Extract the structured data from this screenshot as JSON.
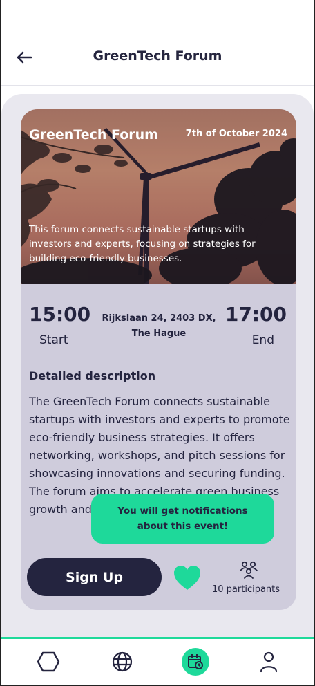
{
  "header": {
    "title": "GreenTech Forum",
    "back_icon": "arrow-left-icon"
  },
  "event": {
    "title": "GreenTech Forum",
    "date": "7th of October 2024",
    "summary": "This forum connects sustainable startups with investors and experts, focusing on strategies for building eco-friendly businesses.",
    "start_time": "15:00",
    "start_label": "Start",
    "end_time": "17:00",
    "end_label": "End",
    "address": "Rijkslaan 24, 2403 DX, The Hague",
    "description_heading": "Detailed description",
    "description": "The GreenTech Forum connects sustainable startups with investors and experts to promote eco-friendly business strategies. It offers networking, workshops, and pitch sessions for showcasing innovations and securing funding. The forum aims to accelerate green business growth and foster collaboration."
  },
  "toast": {
    "message": "You will get notifications about this event!"
  },
  "actions": {
    "signup_label": "Sign Up",
    "favorite_icon": "heart-icon",
    "participants_icon": "people-icon",
    "participants_label": "10 participants"
  },
  "nav": {
    "items": [
      {
        "icon": "hexagon-icon",
        "active": false
      },
      {
        "icon": "globe-icon",
        "active": false
      },
      {
        "icon": "calendar-clock-icon",
        "active": true
      },
      {
        "icon": "user-icon",
        "active": false
      }
    ]
  },
  "colors": {
    "accent": "#1ed99a",
    "dark": "#24243f",
    "card": "#cfccdc",
    "background": "#e9e8ef"
  }
}
